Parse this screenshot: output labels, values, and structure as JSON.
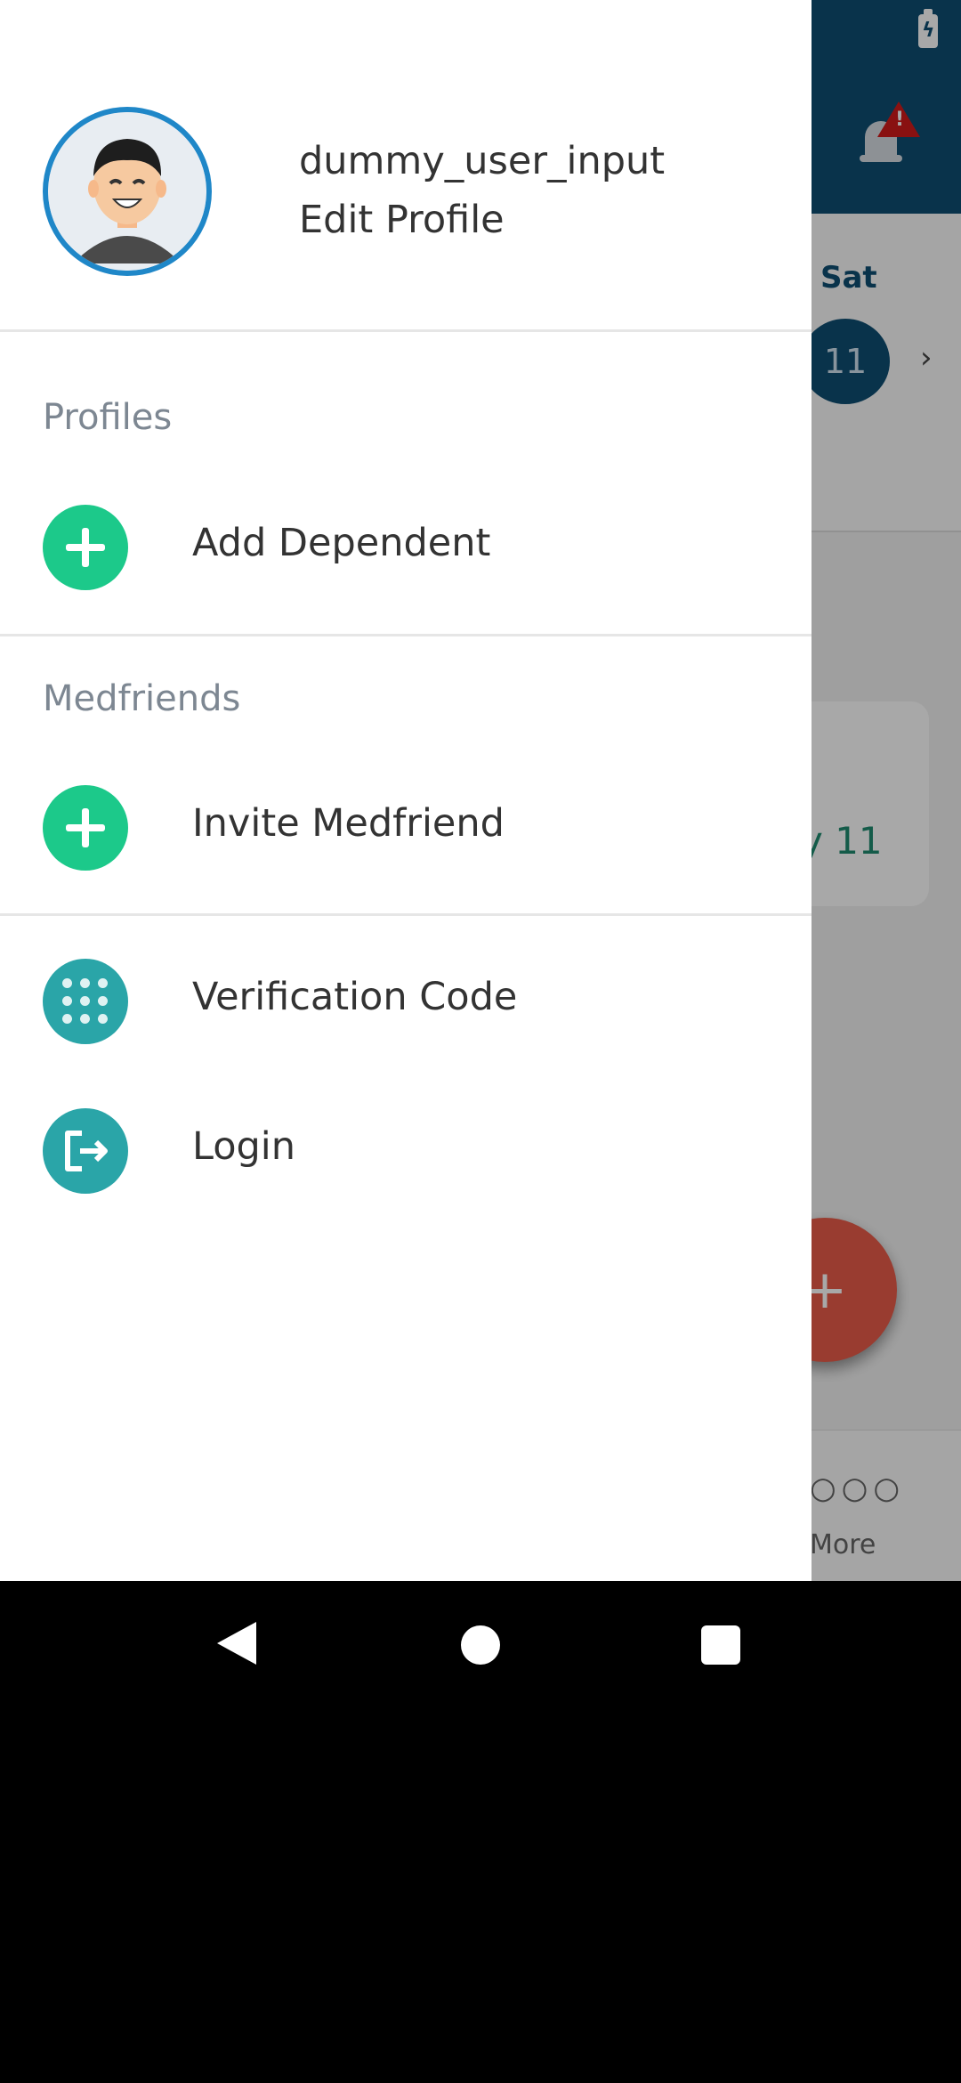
{
  "status": {
    "battery_icon": "battery-charging-icon"
  },
  "background": {
    "day_label": "Sat",
    "day_number": "11",
    "chevron": "›",
    "card_text": "y 11",
    "fab_label": "+",
    "more_dots": "○○○",
    "more_label": "More"
  },
  "drawer": {
    "username": "dummy_user_input",
    "edit_profile": "Edit Profile",
    "sections": {
      "profiles": "Profiles",
      "medfriends": "Medfriends"
    },
    "items": {
      "add_dependent": "Add Dependent",
      "invite_medfriend": "Invite Medfriend",
      "verification_code": "Verification Code",
      "login": "Login"
    }
  },
  "colors": {
    "header_blue": "#0e4e73",
    "green_icon": "#1cc98a",
    "teal_icon": "#2aa5a8",
    "avatar_ring": "#1f87c8",
    "fab_red": "#e85c4a"
  }
}
